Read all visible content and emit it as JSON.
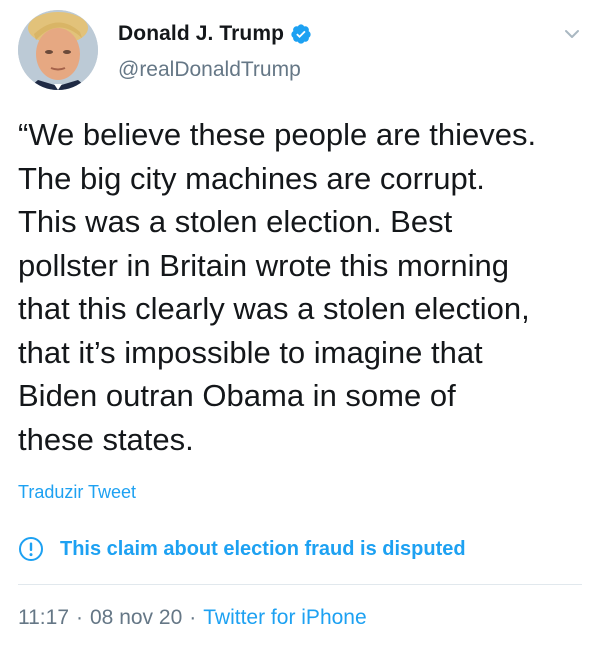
{
  "author": {
    "display_name": "Donald J. Trump",
    "handle": "@realDonaldTrump",
    "verified_icon": "verified-badge-icon",
    "avatar_icon": "profile-avatar"
  },
  "menu": {
    "icon": "chevron-down-icon"
  },
  "tweet": {
    "text": "“We believe these people are thieves.\nThe big city machines are corrupt.\nThis was a stolen election. Best\npollster in Britain wrote this morning\nthat this clearly was a stolen election,\nthat it’s impossible to imagine that\nBiden outran Obama in some of\nthese states."
  },
  "translate": {
    "label": "Traduzir Tweet"
  },
  "notice": {
    "icon": "exclamation-circle-icon",
    "text": "This claim about election fraud is disputed"
  },
  "meta": {
    "time": "11:17",
    "separator": "·",
    "date": "08 nov 20",
    "source": "Twitter for iPhone"
  },
  "colors": {
    "accent": "#1da1f2",
    "text": "#14171a",
    "secondary_text": "#657786",
    "divider": "#e1e8ed"
  }
}
